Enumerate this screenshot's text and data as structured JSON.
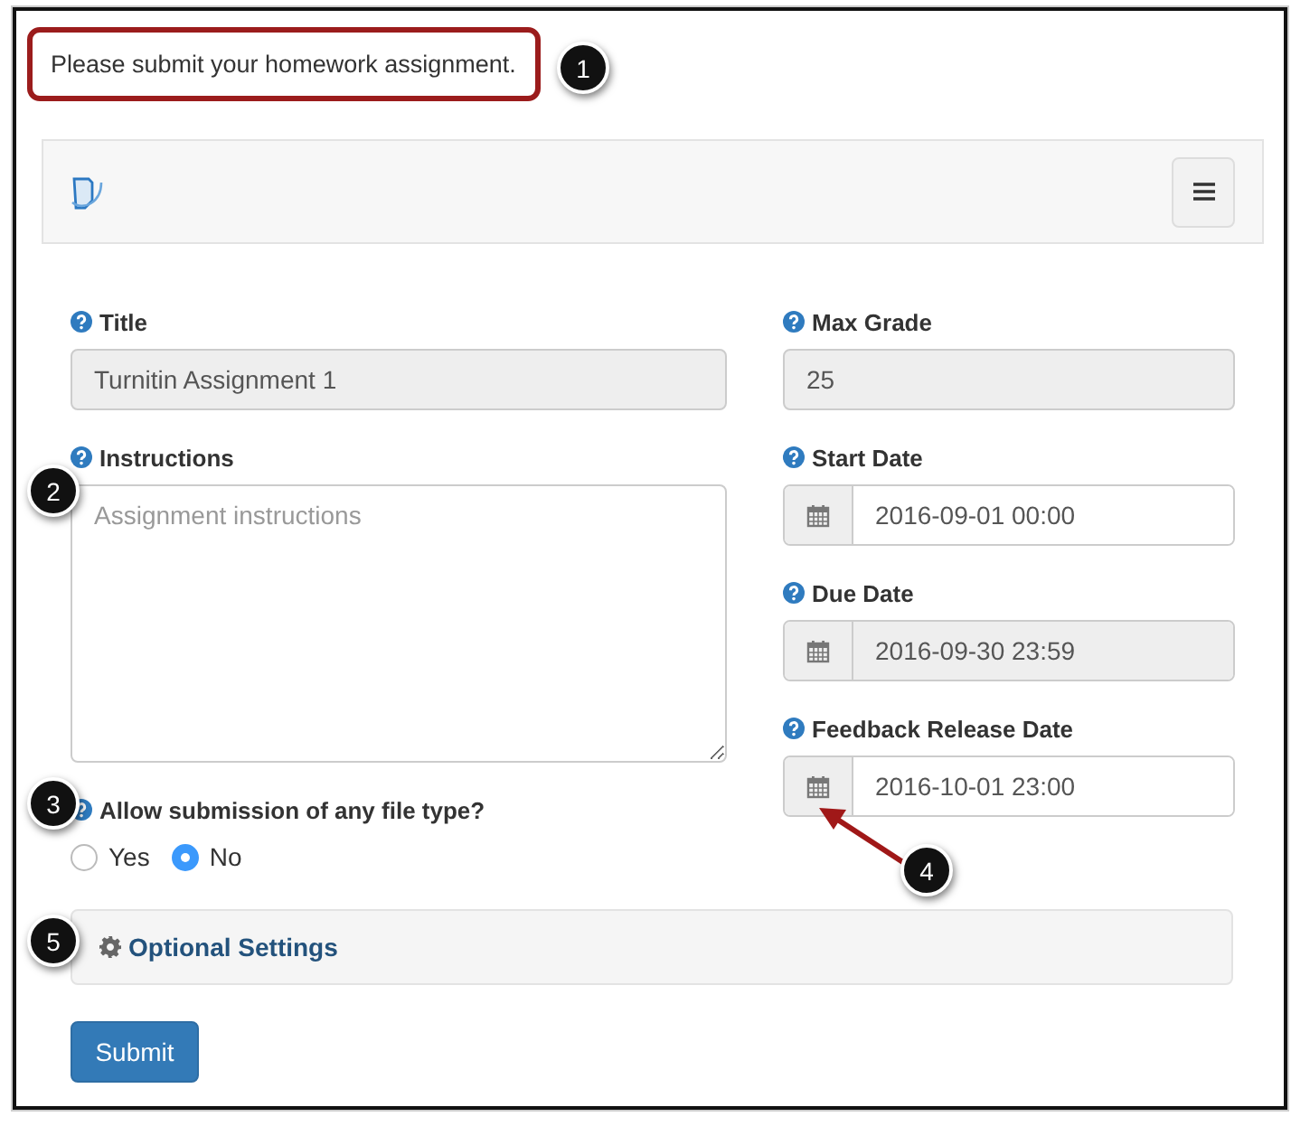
{
  "message": "Please submit your homework assignment.",
  "left_fields": [
    {
      "kind": "input",
      "label": "Title",
      "value": "Turnitin Assignment 1",
      "disabled": true
    },
    {
      "kind": "textarea",
      "label": "Instructions",
      "placeholder": "Assignment instructions"
    },
    {
      "kind": "radio",
      "label": "Allow submission of any file type?",
      "options": [
        {
          "label": "Yes",
          "selected": false
        },
        {
          "label": "No",
          "selected": true
        }
      ]
    }
  ],
  "right_fields": [
    {
      "kind": "input",
      "label": "Max Grade",
      "value": "25",
      "disabled": true
    },
    {
      "kind": "date",
      "label": "Start Date",
      "value": "2016-09-01 00:00",
      "disabled": false
    },
    {
      "kind": "date",
      "label": "Due Date",
      "value": "2016-09-30 23:59",
      "disabled": true
    },
    {
      "kind": "date",
      "label": "Feedback Release Date",
      "value": "2016-10-01 23:00",
      "disabled": false
    }
  ],
  "optional_settings": "Optional Settings",
  "submit": "Submit",
  "callouts": [
    "1",
    "2",
    "3",
    "4",
    "5"
  ]
}
